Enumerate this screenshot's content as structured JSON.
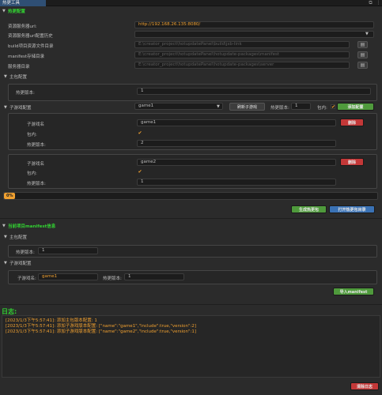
{
  "window": {
    "tab_title": "热更工具",
    "ctrl1": "⧉",
    "ctrl2": "⋮"
  },
  "hot_config": {
    "section_title": "热更配置",
    "server_url_label": "资源服务器url:",
    "server_url_value": "http://192.168.26.135:8080/",
    "url_history_label": "资源服务器url配置历史",
    "url_history_value": "",
    "build_dir_label": "build项目资源文件目录",
    "build_dir_value": "E:\\creator_project\\hotupdatePanel\\build\\jsb-link",
    "manifest_dir_label": "manifest存储目录",
    "manifest_dir_value": "E:\\creator_project\\hotupdatePanel\\hotupdate-packages\\manifest",
    "server_dir_label": "服务器目录",
    "server_dir_value": "E:\\creator_project\\hotupdatePanel\\hotupdate-packages\\server"
  },
  "main_pkg": {
    "title": "主包配置",
    "version_label": "热更版本:",
    "version_value": "1"
  },
  "sub_game": {
    "title": "子游戏配置",
    "selected_game": "game1",
    "refresh_label": "刷新子游戏",
    "hot_version_label": "热更版本:",
    "hot_version_value": "1",
    "in_package_label": "包内:",
    "add_label": "添加配置",
    "entries": [
      {
        "name_label": "子游戏名",
        "name_value": "game1",
        "delete_label": "删除",
        "in_package_label": "包内:",
        "version_label": "热更版本:",
        "version_value": "2"
      },
      {
        "name_label": "子游戏名",
        "name_value": "game2",
        "delete_label": "删除",
        "in_package_label": "包内:",
        "version_label": "热更版本:",
        "version_value": "1"
      }
    ]
  },
  "progress": {
    "text": "0%",
    "fraction": 0
  },
  "actions": {
    "generate_label": "生成热更包",
    "open_label": "打开热更包目录"
  },
  "current_manifest": {
    "section_title": "当前项目manifest信息",
    "main_title": "主包配置",
    "main_version_label": "热更版本:",
    "main_version_value": "1",
    "sub_title": "子游戏配置",
    "sub_name_label": "子游戏名:",
    "sub_name_value": "game1",
    "sub_version_label": "热更版本:",
    "sub_version_value": "1",
    "import_label": "导入manifest"
  },
  "log": {
    "title": "日志:",
    "lines": [
      "[2023/1/3下午5:57:41]: 添加主包版本配置: 1",
      "[2023/1/3下午5:57:41]: 添加子游戏版本配置: [\"name\":\"game1\",\"include\":true,\"version\":2]",
      "[2023/1/3下午5:57:41]: 添加子游戏版本配置: [\"name\":\"game2\",\"include\":true,\"version\":1]"
    ],
    "clear_label": "清除日志"
  },
  "colors": {
    "green_text": "#32d232",
    "orange_text": "#f0a030",
    "green_btn": "#4f9a3c",
    "blue_btn": "#3a72b5",
    "red_btn": "#c43838"
  },
  "icons": [
    "triangle-down-icon",
    "folder-icon",
    "chevron-down-icon",
    "checkmark-icon"
  ]
}
